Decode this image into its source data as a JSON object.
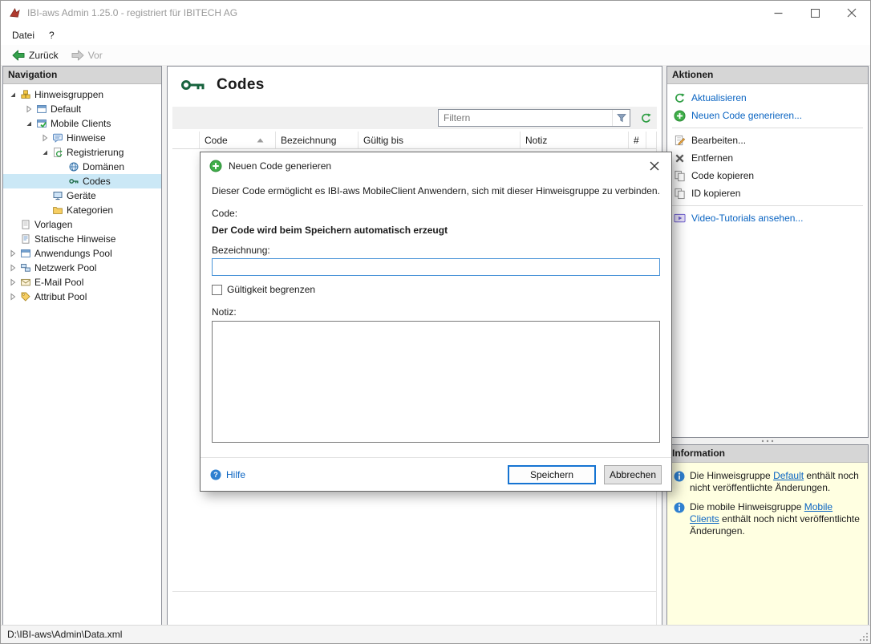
{
  "window": {
    "title": "IBI-aws Admin 1.25.0 - registriert für IBITECH AG",
    "status_path": "D:\\IBI-aws\\Admin\\Data.xml"
  },
  "menu": {
    "datei": "Datei",
    "help": "?"
  },
  "toolbar": {
    "back": "Zurück",
    "forward": "Vor"
  },
  "navigation": {
    "header": "Navigation",
    "tree": [
      {
        "label": "Hinweisgruppen"
      },
      {
        "label": "Default"
      },
      {
        "label": "Mobile Clients"
      },
      {
        "label": "Hinweise"
      },
      {
        "label": "Registrierung"
      },
      {
        "label": "Domänen"
      },
      {
        "label": "Codes"
      },
      {
        "label": "Geräte"
      },
      {
        "label": "Kategorien"
      },
      {
        "label": "Vorlagen"
      },
      {
        "label": "Statische Hinweise"
      },
      {
        "label": "Anwendungs Pool"
      },
      {
        "label": "Netzwerk Pool"
      },
      {
        "label": "E-Mail Pool"
      },
      {
        "label": "Attribut Pool"
      }
    ]
  },
  "main": {
    "title": "Codes",
    "filter": {
      "placeholder": "Filtern"
    },
    "table": {
      "columns": [
        "Code",
        "Bezeichnung",
        "Gültig bis",
        "Notiz",
        "#"
      ]
    }
  },
  "dialog": {
    "title": "Neuen Code generieren",
    "description": "Dieser Code ermöglicht es IBI-aws MobileClient Anwendern, sich mit dieser Hinweisgruppe zu verbinden.",
    "code_label": "Code:",
    "code_hint": "Der Code wird beim Speichern automatisch erzeugt",
    "name_label": "Bezeichnung:",
    "name_value": "",
    "limit_checkbox": "Gültigkeit begrenzen",
    "note_label": "Notiz:",
    "note_value": "",
    "help": "Hilfe",
    "save": "Speichern",
    "cancel": "Abbrechen"
  },
  "actions": {
    "header": "Aktionen",
    "items": [
      {
        "label": "Aktualisieren"
      },
      {
        "label": "Neuen Code generieren..."
      },
      {
        "label": "Bearbeiten..."
      },
      {
        "label": "Entfernen"
      },
      {
        "label": "Code kopieren"
      },
      {
        "label": "ID kopieren"
      },
      {
        "label": "Video-Tutorials ansehen..."
      }
    ]
  },
  "information": {
    "header": "Information",
    "items": [
      {
        "prefix": "Die Hinweisgruppe ",
        "link": "Default",
        "suffix": " enthält noch nicht veröffentlichte Änderungen."
      },
      {
        "prefix": "Die mobile Hinweisgruppe ",
        "link": "Mobile Clients",
        "suffix": " enthält noch nicht veröffentlichte Änderungen."
      }
    ]
  }
}
